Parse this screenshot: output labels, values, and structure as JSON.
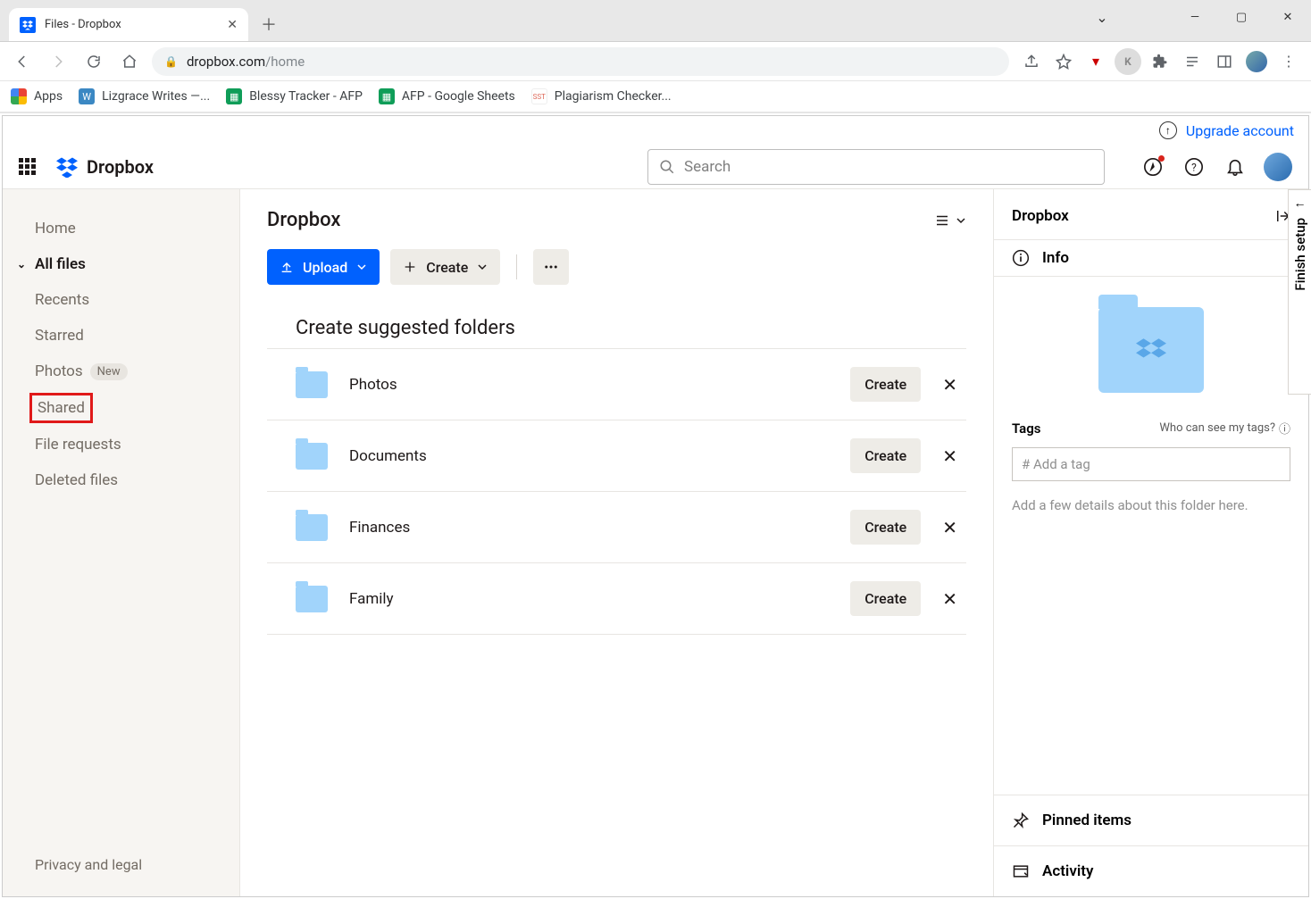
{
  "browser": {
    "tab_title": "Files - Dropbox",
    "url_display_host": "dropbox.com",
    "url_display_path": "/home"
  },
  "bookmarks": {
    "apps": "Apps",
    "items": [
      {
        "label": "Lizgrace Writes —...",
        "color": "#3b88c3",
        "glyph": "W"
      },
      {
        "label": "Blessy Tracker - AFP",
        "color": "#0f9d58",
        "glyph": "▦"
      },
      {
        "label": "AFP - Google Sheets",
        "color": "#0f9d58",
        "glyph": "▦"
      },
      {
        "label": "Plagiarism Checker...",
        "color": "#fff",
        "glyph": "SST",
        "text": "#d65"
      }
    ]
  },
  "header": {
    "upgrade": "Upgrade account",
    "logo_text": "Dropbox",
    "search_placeholder": "Search"
  },
  "sidebar": {
    "items": [
      {
        "label": "Home"
      },
      {
        "label": "All files",
        "active": true,
        "chevron": true
      },
      {
        "label": "Recents"
      },
      {
        "label": "Starred"
      },
      {
        "label": "Photos",
        "badge": "New"
      },
      {
        "label": "Shared",
        "highlight": true
      },
      {
        "label": "File requests"
      },
      {
        "label": "Deleted files"
      }
    ],
    "footer": "Privacy and legal"
  },
  "main": {
    "title": "Dropbox",
    "upload_label": "Upload",
    "create_label": "Create",
    "suggested_title": "Create suggested folders",
    "create_btn": "Create",
    "suggestions": [
      {
        "name": "Photos"
      },
      {
        "name": "Documents"
      },
      {
        "name": "Finances"
      },
      {
        "name": "Family"
      }
    ]
  },
  "details": {
    "title": "Dropbox",
    "info_label": "Info",
    "tags_label": "Tags",
    "tags_help": "Who can see my tags?",
    "tag_placeholder": "# Add a tag",
    "note": "Add a few details about this folder here.",
    "pinned_label": "Pinned items",
    "activity_label": "Activity"
  },
  "finish_setup": "Finish setup"
}
